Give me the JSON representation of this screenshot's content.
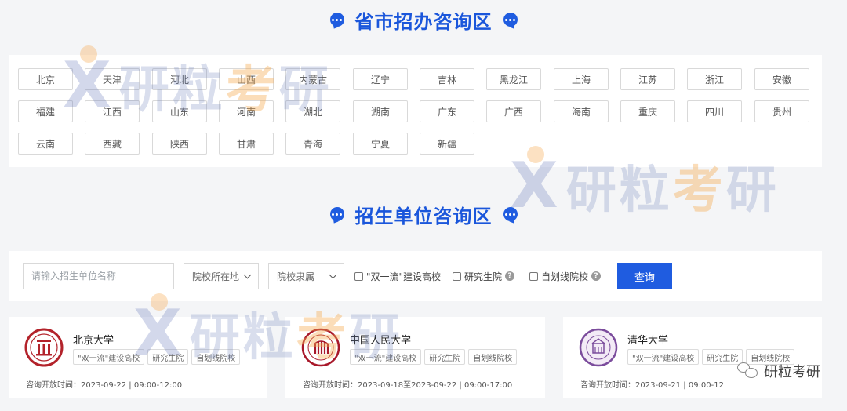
{
  "sections": {
    "province_title": "省市招办咨询区",
    "unit_title": "招生单位咨询区"
  },
  "provinces": [
    "北京",
    "天津",
    "河北",
    "山西",
    "内蒙古",
    "辽宁",
    "吉林",
    "黑龙江",
    "上海",
    "江苏",
    "浙江",
    "安徽",
    "福建",
    "江西",
    "山东",
    "河南",
    "湖北",
    "湖南",
    "广东",
    "广西",
    "海南",
    "重庆",
    "四川",
    "贵州",
    "云南",
    "西藏",
    "陕西",
    "甘肃",
    "青海",
    "宁夏",
    "新疆"
  ],
  "search": {
    "placeholder": "请输入招生单位名称",
    "location_select": "院校所在地",
    "affiliation_select": "院校隶属",
    "checkbox_double_first": "\"双一流\"建设高校",
    "checkbox_grad_school": "研究生院",
    "checkbox_self_line": "自划线院校",
    "query_button": "查询"
  },
  "universities": [
    {
      "name": "北京大学",
      "tags": [
        "\"双一流\"建设高校",
        "研究生院",
        "自划线院校"
      ],
      "time": "咨询开放时间：2023-09-22 | 09:00-12:00"
    },
    {
      "name": "中国人民大学",
      "tags": [
        "\"双一流\"建设高校",
        "研究生院",
        "自划线院校"
      ],
      "time": "咨询开放时间：2023-09-18至2023-09-22 | 09:00-17:00"
    },
    {
      "name": "清华大学",
      "tags": [
        "\"双一流\"建设高校",
        "研究生院",
        "自划线院校"
      ],
      "time": "咨询开放时间：2023-09-21 | 09:00-12"
    }
  ],
  "watermark": {
    "x": "X",
    "text_before": "研粒",
    "v": "考",
    "text_after": "研"
  },
  "wechat_label": "研粒考研",
  "colors": {
    "accent": "#1f5ce0",
    "title": "#1a56db",
    "pku_red": "#b3232b",
    "ruc_red": "#a8182a",
    "thu_purple": "#7b4c9c"
  }
}
